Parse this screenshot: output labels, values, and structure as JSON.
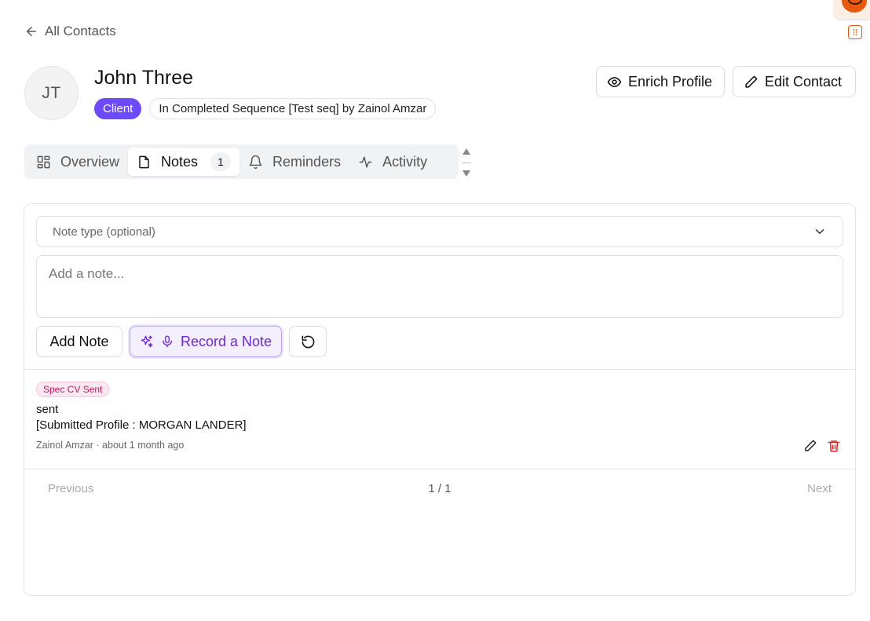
{
  "nav": {
    "back_label": "All Contacts"
  },
  "contact": {
    "initials": "JT",
    "name": "John Three",
    "type_badge": "Client",
    "sequence_badge": "In Completed Sequence [Test seq] by Zainol Amzar"
  },
  "header_actions": {
    "enrich_label": "Enrich Profile",
    "edit_label": "Edit Contact"
  },
  "tabs": [
    {
      "label": "Overview",
      "icon": "grid-icon",
      "active": false
    },
    {
      "label": "Notes",
      "icon": "file-icon",
      "active": true,
      "count": "1"
    },
    {
      "label": "Reminders",
      "icon": "bell-icon",
      "active": false
    },
    {
      "label": "Activity",
      "icon": "activity-icon",
      "active": false
    }
  ],
  "composer": {
    "note_type_placeholder": "Note type (optional)",
    "note_placeholder": "Add a note...",
    "note_value": "",
    "add_label": "Add Note",
    "record_label": "Record a Note"
  },
  "notes": [
    {
      "tag": "Spec CV Sent",
      "line1": "sent",
      "line2": "[Submitted Profile : MORGAN LANDER]",
      "meta": "Zainol Amzar · about 1 month ago"
    }
  ],
  "pagination": {
    "prev": "Previous",
    "info": "1 / 1",
    "next": "Next"
  },
  "colors": {
    "accent": "#6d4aff",
    "record_text": "#6d28d9",
    "tag_bg": "#fde7f1",
    "tag_text": "#c2185b",
    "delete": "#dc2626",
    "widget": "#e8590c"
  }
}
